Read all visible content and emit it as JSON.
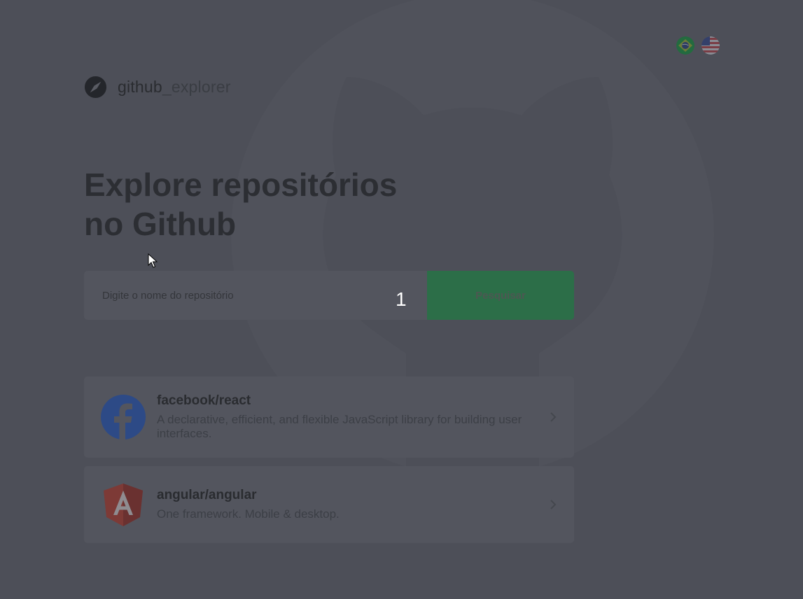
{
  "header": {
    "brand_bold": "github",
    "brand_light": "_explorer",
    "languages": [
      {
        "name": "pt-BR",
        "flag": "brazil-flag"
      },
      {
        "name": "en-US",
        "flag": "usa-flag"
      }
    ]
  },
  "hero": {
    "title_line1": "Explore repositórios",
    "title_line2": "no Github"
  },
  "search": {
    "placeholder": "Digite o nome do repositório",
    "value": "",
    "button_label": "Pesquisar"
  },
  "overlay": {
    "step_number": "1"
  },
  "repositories": [
    {
      "full_name": "facebook/react",
      "description": "A declarative, efficient, and flexible JavaScript library for building user interfaces.",
      "avatar_icon": "facebook-logo-icon"
    },
    {
      "full_name": "angular/angular",
      "description": "One framework. Mobile & desktop.",
      "avatar_icon": "angular-logo-icon"
    }
  ],
  "colors": {
    "background": "#4d4f58",
    "accent_green": "#2c6e48",
    "card_bg": "#53555e",
    "text_dark": "#2a2c30"
  }
}
